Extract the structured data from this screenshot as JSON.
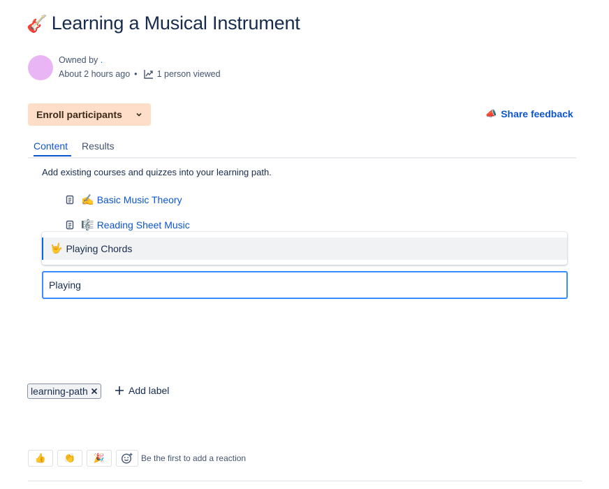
{
  "page": {
    "title_emoji": "🎸",
    "title": "Learning a Musical Instrument"
  },
  "byline": {
    "owned_by": "Owned by",
    "owner": ".",
    "updated": "About 2 hours ago",
    "separator": "•",
    "views": "1 person viewed"
  },
  "actions": {
    "enroll_label": "Enroll participants",
    "feedback_label": "Share feedback"
  },
  "tabs": [
    {
      "label": "Content",
      "active": true
    },
    {
      "label": "Results",
      "active": false
    }
  ],
  "content": {
    "hint": "Add existing courses and quizzes into your learning path.",
    "items": [
      {
        "emoji": "✍️",
        "label": "Basic Music Theory"
      },
      {
        "emoji": "🎼",
        "label": "Reading Sheet Music"
      }
    ],
    "suggestion": {
      "emoji": "🤟",
      "label": "Playing Chords"
    },
    "search_value": "Playing"
  },
  "labels": {
    "chips": [
      "learning-path"
    ],
    "add_label": "Add label"
  },
  "reactions": {
    "emojis": [
      "👍",
      "👏",
      "🎉"
    ],
    "hint": "Be the first to add a reaction"
  },
  "colors": {
    "accent": "#0c55cf",
    "enroll_bg": "#fedec8",
    "avatar": "#eab5f5",
    "focus": "#388bff"
  }
}
